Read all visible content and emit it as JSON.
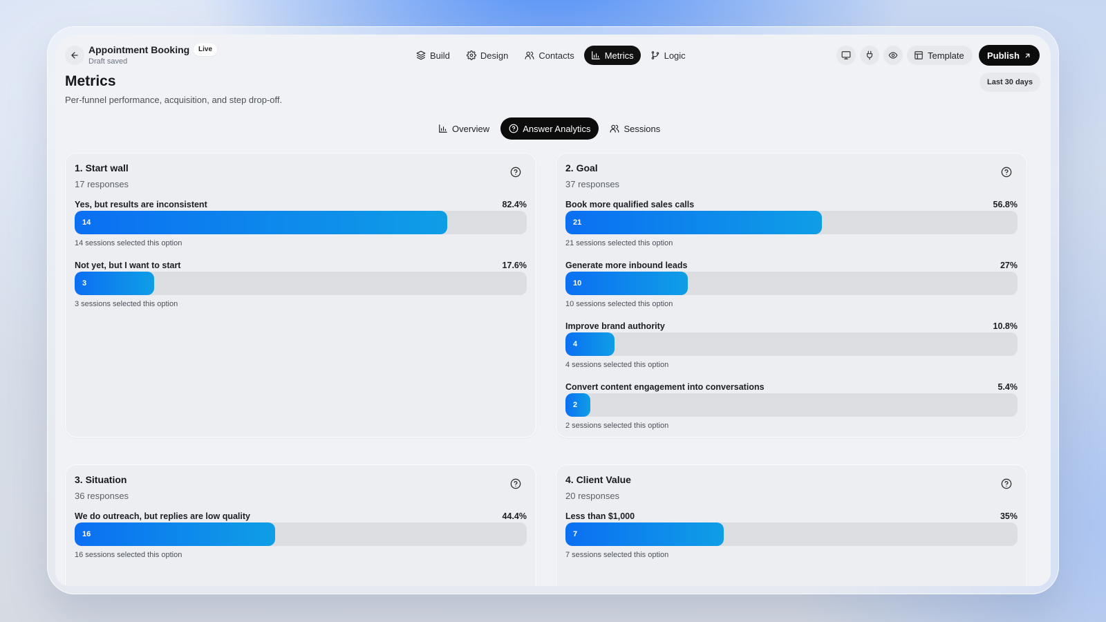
{
  "header": {
    "title": "Appointment Booking",
    "badge": "Live",
    "status": "Draft saved",
    "nav": [
      {
        "label": "Build",
        "icon": "layers-icon",
        "active": false
      },
      {
        "label": "Design",
        "icon": "gear-icon",
        "active": false
      },
      {
        "label": "Contacts",
        "icon": "users-icon",
        "active": false
      },
      {
        "label": "Metrics",
        "icon": "bar-chart-icon",
        "active": true
      },
      {
        "label": "Logic",
        "icon": "branch-icon",
        "active": false
      }
    ],
    "actions": {
      "icons": [
        "desktop-icon",
        "plug-icon",
        "eye-icon"
      ],
      "template_label": "Template",
      "publish_label": "Publish"
    }
  },
  "page": {
    "title": "Metrics",
    "subtitle": "Per-funnel performance, acquisition, and step drop-off.",
    "date_range": "Last 30 days"
  },
  "tabs": [
    {
      "label": "Overview",
      "icon": "bar-chart-icon",
      "active": false
    },
    {
      "label": "Answer Analytics",
      "icon": "help-circle-icon",
      "active": true
    },
    {
      "label": "Sessions",
      "icon": "users-icon",
      "active": false
    }
  ],
  "accent_colors": {
    "bar_start": "#0b6ff2",
    "bar_end": "#0f9ee6",
    "track": "#dcdee2"
  },
  "cards": [
    {
      "title": "1. Start wall",
      "responses": "17 responses",
      "options": [
        {
          "label": "Yes, but results are inconsistent",
          "percent": "82.4%",
          "count": "14",
          "share": 0.824,
          "note": "14 sessions selected this option"
        },
        {
          "label": "Not yet, but I want to start",
          "percent": "17.6%",
          "count": "3",
          "share": 0.176,
          "note": "3 sessions selected this option"
        }
      ]
    },
    {
      "title": "2. Goal",
      "responses": "37 responses",
      "options": [
        {
          "label": "Book more qualified sales calls",
          "percent": "56.8%",
          "count": "21",
          "share": 0.568,
          "note": "21 sessions selected this option"
        },
        {
          "label": "Generate more inbound leads",
          "percent": "27%",
          "count": "10",
          "share": 0.27,
          "note": "10 sessions selected this option"
        },
        {
          "label": "Improve brand authority",
          "percent": "10.8%",
          "count": "4",
          "share": 0.108,
          "note": "4 sessions selected this option"
        },
        {
          "label": "Convert content engagement into conversations",
          "percent": "5.4%",
          "count": "2",
          "share": 0.054,
          "note": "2 sessions selected this option"
        }
      ]
    },
    {
      "title": "3. Situation",
      "responses": "36 responses",
      "options": [
        {
          "label": "We do outreach, but replies are low quality",
          "percent": "44.4%",
          "count": "16",
          "share": 0.444,
          "note": "16 sessions selected this option"
        }
      ]
    },
    {
      "title": "4. Client Value",
      "responses": "20 responses",
      "options": [
        {
          "label": "Less than $1,000",
          "percent": "35%",
          "count": "7",
          "share": 0.35,
          "note": "7 sessions selected this option"
        }
      ]
    }
  ]
}
